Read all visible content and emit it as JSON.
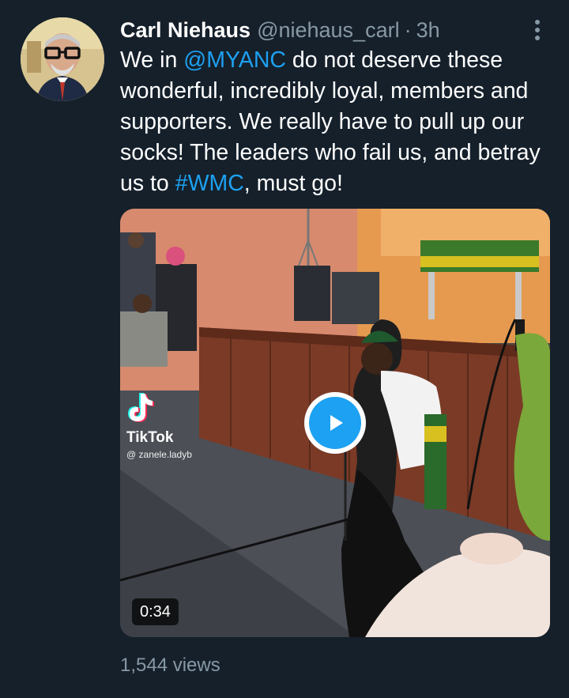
{
  "tweet": {
    "author": {
      "display_name": "Carl Niehaus",
      "handle": "@niehaus_carl",
      "separator": "·",
      "time": "3h",
      "avatar_icon": "profile-photo"
    },
    "text": {
      "part1": "We in ",
      "mention": "@MYANC",
      "part2": " do not deserve these wonderful, incredibly loyal, members and supporters. We really have to pull up our socks! The leaders who fail us, and betray us to ",
      "hashtag": "#WMC",
      "part3": ", must go!"
    },
    "media": {
      "type": "video",
      "watermark_brand": "TikTok",
      "watermark_user": "@ zanele.ladyb",
      "duration": "0:34",
      "play_icon": "play-icon"
    },
    "views": "1,544 views",
    "more_icon": "more-vertical-icon"
  },
  "colors": {
    "background": "#15202b",
    "link": "#1da1f2",
    "secondary_text": "#8899a6",
    "primary_text": "#ffffff"
  }
}
